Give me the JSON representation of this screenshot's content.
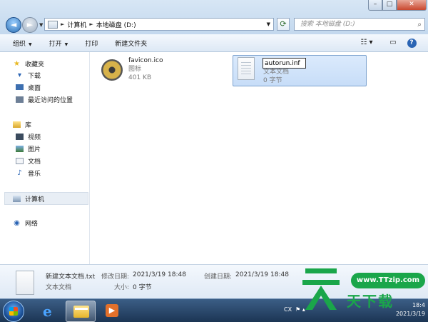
{
  "window": {
    "minimize": "–",
    "maximize": "□",
    "close": "✕"
  },
  "nav": {
    "back": "◄",
    "forward": "►"
  },
  "address": {
    "crumbs": [
      "计算机",
      "本地磁盘 (D:)"
    ]
  },
  "search": {
    "placeholder": "搜索 本地磁盘 (D:)"
  },
  "toolbar": {
    "organize": "组织",
    "open": "打开",
    "print": "打印",
    "new_folder": "新建文件夹",
    "help": "?"
  },
  "sidebar": {
    "favorites": {
      "label": "收藏夹",
      "items": [
        "下载",
        "桌面",
        "最近访问的位置"
      ]
    },
    "libraries": {
      "label": "库",
      "items": [
        "视频",
        "图片",
        "文档",
        "音乐"
      ]
    },
    "computer": "计算机",
    "network": "网络"
  },
  "files": [
    {
      "name": "favicon.ico",
      "type": "图标",
      "size": "401 KB",
      "icon": "disk-image-icon"
    },
    {
      "name": "autorun.inf",
      "type": "文本文档",
      "size": "0 字节",
      "icon": "text-document-icon",
      "renaming": true
    }
  ],
  "details": {
    "filename": "新建文本文档.txt",
    "filetype": "文本文档",
    "modified_label": "修改日期:",
    "modified": "2021/3/19 18:48",
    "created_label": "创建日期:",
    "created": "2021/3/19 18:48",
    "size_label": "大小:",
    "size": "0 字节"
  },
  "taskbar": {
    "lang": "CX",
    "time": "18:4",
    "date": "2021/3/19"
  },
  "watermark": {
    "site": "www.TTzip.com",
    "text": "天下载"
  },
  "colors": {
    "accent": "#2c6fb4",
    "selection": "#c7ddf8",
    "watermark": "#1aa64a"
  }
}
